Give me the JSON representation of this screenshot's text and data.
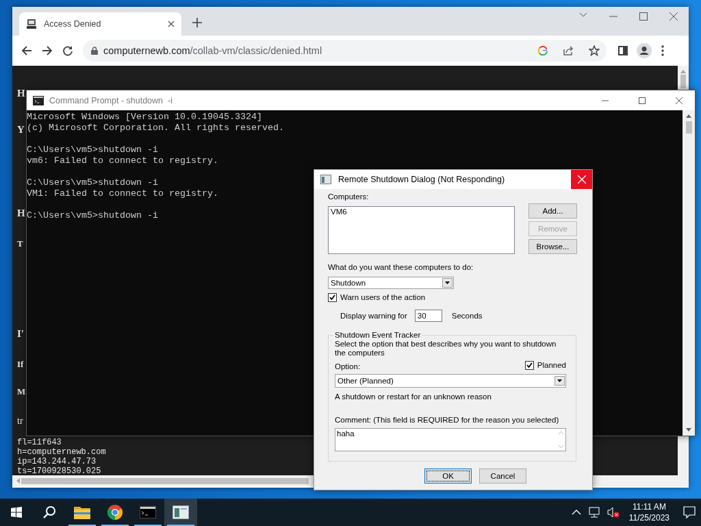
{
  "browser": {
    "tab": {
      "title": "Access Denied"
    },
    "address": {
      "host": "computernewb.com",
      "path": "/collab-vm/classic/denied.html"
    },
    "page": {
      "items": [
        {
          "kind": "heading",
          "text": "H"
        },
        {
          "kind": "heading",
          "text": "Y"
        },
        {
          "kind": "heading",
          "text": "H"
        },
        {
          "kind": "subheading",
          "text": "T"
        },
        {
          "kind": "heading",
          "text": "I'"
        },
        {
          "kind": "subheading",
          "text": "If"
        },
        {
          "kind": "subheading",
          "text": "M"
        },
        {
          "kind": "paragraph",
          "text": "tr"
        }
      ],
      "lines": [
        "fl=11f643",
        "h=computernewb.com",
        "ip=143.244.47.73",
        "ts=1700928530.025"
      ]
    }
  },
  "console": {
    "title": "Command Prompt - shutdown  -i",
    "blocks": [
      [
        "Microsoft Windows [Version 10.0.19045.3324]",
        "(c) Microsoft Corporation. All rights reserved."
      ],
      [
        "C:\\Users\\vm5>shutdown -i",
        "vm6: Failed to connect to registry."
      ],
      [
        "C:\\Users\\vm5>shutdown -i",
        "VM1: Failed to connect to registry."
      ],
      [
        "C:\\Users\\vm5>shutdown -i"
      ]
    ]
  },
  "dialog": {
    "title": "Remote Shutdown Dialog (Not Responding)",
    "computers_label": "Computers:",
    "computers": [
      "VM6"
    ],
    "buttons": [
      {
        "label": "Add...",
        "disabled": false
      },
      {
        "label": "Remove",
        "disabled": true
      },
      {
        "label": "Browse...",
        "disabled": false
      }
    ],
    "action_label": "What do you want these computers to do:",
    "action": "Shutdown",
    "warn": {
      "label": "Warn users of the action",
      "checked": true
    },
    "warning_label": "Display warning for",
    "warning_value": "30",
    "warning_unit": "Seconds",
    "tracker": {
      "title": "Shutdown Event Tracker",
      "description": "Select the option that best describes why you want to shutdown the computers",
      "option_label": "Option:",
      "planned": {
        "label": "Planned",
        "checked": true
      },
      "option": "Other (Planned)",
      "option_description": "A shutdown or restart for an unknown reason",
      "comment_label": "Comment: (This field is REQUIRED for the reason you selected)",
      "comment": "haha"
    },
    "actions": [
      {
        "label": "OK",
        "default": true
      },
      {
        "label": "Cancel",
        "default": false
      }
    ]
  },
  "taskbar": {
    "apps": [
      {
        "kind": "folder",
        "running": true,
        "selected": false
      },
      {
        "kind": "browser",
        "running": true,
        "selected": false
      },
      {
        "kind": "console",
        "running": true,
        "selected": false
      },
      {
        "kind": "dialog",
        "running": true,
        "selected": true
      }
    ],
    "time": "11:11 AM",
    "date": "11/25/2023"
  }
}
